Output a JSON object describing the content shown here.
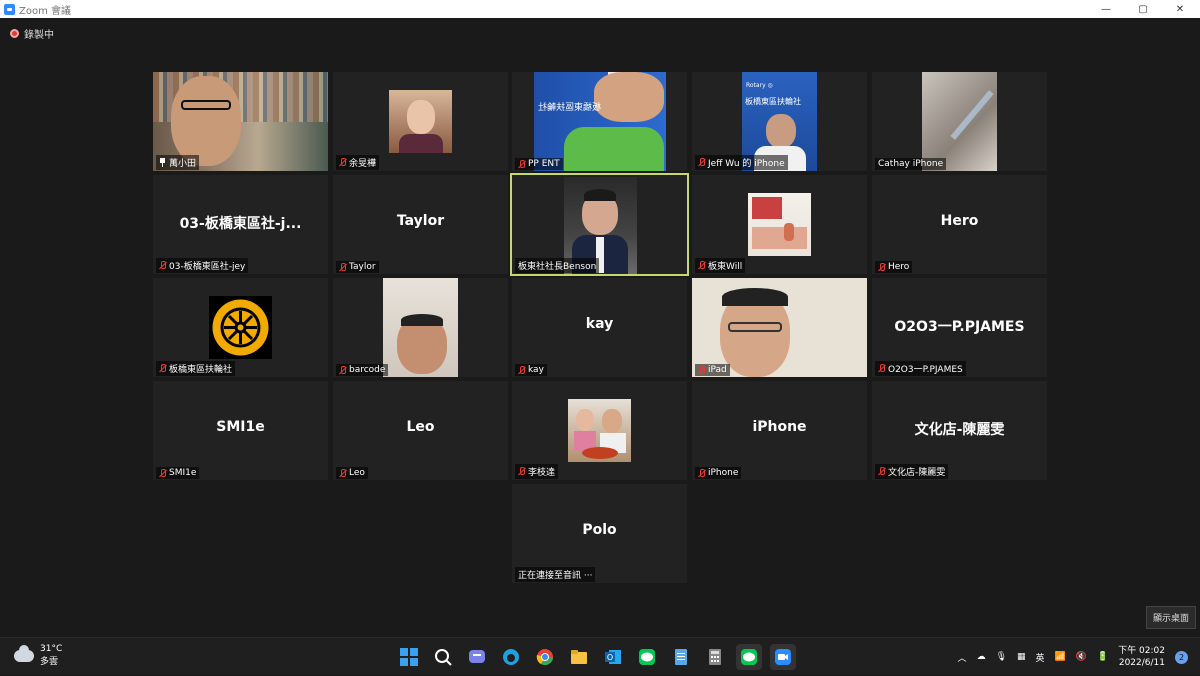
{
  "window": {
    "title": "Zoom 會議",
    "minimize": "—",
    "maximize": "▢",
    "close": "✕"
  },
  "recording": {
    "label": "錄製中"
  },
  "participants": [
    {
      "name": "萬小田",
      "display": "",
      "mic": "pin",
      "has_video": true
    },
    {
      "name": "余旻樺",
      "display": "",
      "mic": "muted",
      "has_video": true
    },
    {
      "name": "PP ENT",
      "display": "",
      "mic": "muted",
      "has_video": true,
      "banner": "板橋東區扶輪社"
    },
    {
      "name": "Jeff Wu 的 iPhone",
      "display": "",
      "mic": "muted",
      "has_video": true,
      "banner": "板橋東區扶輪社"
    },
    {
      "name": "Cathay iPhone",
      "display": "",
      "mic": "none",
      "has_video": true
    },
    {
      "name": "03-板橋東區社-jey",
      "display": "03-板橋東區社-j...",
      "mic": "muted",
      "has_video": false
    },
    {
      "name": "Taylor",
      "display": "Taylor",
      "mic": "muted",
      "has_video": false
    },
    {
      "name": "板東社社長Benson",
      "display": "",
      "mic": "none",
      "has_video": true,
      "active": true
    },
    {
      "name": "板東Will",
      "display": "",
      "mic": "muted",
      "has_video": true
    },
    {
      "name": "Hero",
      "display": "Hero",
      "mic": "muted",
      "has_video": false
    },
    {
      "name": "板橋東區扶輪社",
      "display": "",
      "mic": "muted",
      "has_video": true
    },
    {
      "name": "barcode",
      "display": "",
      "mic": "muted",
      "has_video": true
    },
    {
      "name": "kay",
      "display": "kay",
      "mic": "muted",
      "has_video": false
    },
    {
      "name": "iPad",
      "display": "",
      "mic": "muted",
      "has_video": true
    },
    {
      "name": "O2O3一P.PJAMES",
      "display": "O2O3一P.PJAMES",
      "mic": "muted",
      "has_video": false
    },
    {
      "name": "SMI1e",
      "display": "SMI1e",
      "mic": "muted",
      "has_video": false
    },
    {
      "name": "Leo",
      "display": "Leo",
      "mic": "muted",
      "has_video": false
    },
    {
      "name": "李枝達",
      "display": "",
      "mic": "muted",
      "has_video": true
    },
    {
      "name": "iPhone",
      "display": "iPhone",
      "mic": "muted",
      "has_video": false
    },
    {
      "name": "文化店-陳麗雯",
      "display": "文化店-陳麗雯",
      "mic": "muted",
      "has_video": false
    },
    {
      "name": "正在連接至音訊 ···",
      "display": "Polo",
      "mic": "none",
      "has_video": false
    }
  ],
  "show_desktop": "顯示桌面",
  "taskbar": {
    "weather_temp": "31°C",
    "weather_desc": "多雲",
    "clock_time": "下午 02:02",
    "clock_date": "2022/6/11",
    "notification_count": "2",
    "ime": "英"
  },
  "colors": {
    "active_speaker": "#c5d86d",
    "muted": "#e53935",
    "zoom_blue": "#2d8cff"
  }
}
